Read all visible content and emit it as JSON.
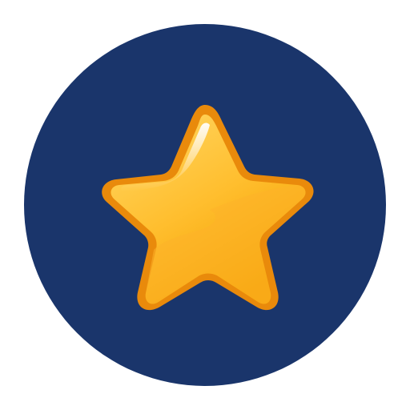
{
  "icon": {
    "name": "star-icon",
    "description_colors": {
      "background": "#1A356B",
      "star_light": "#FFD866",
      "star_mid": "#FFBE2E",
      "star_dark": "#F3A100",
      "outline": "#E98A0B",
      "highlight": "#FFFFFF"
    }
  }
}
